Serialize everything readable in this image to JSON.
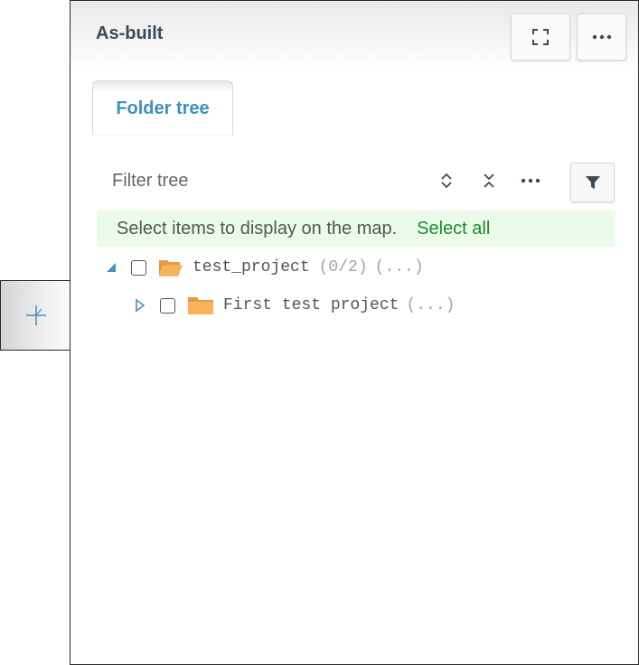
{
  "panel": {
    "title": "As-built",
    "header_buttons": {
      "expand_icon": "fullscreen-icon",
      "more_icon": "more-horizontal-icon"
    }
  },
  "tabs": [
    {
      "label": "Folder tree",
      "active": true
    }
  ],
  "toolbar": {
    "filter_placeholder": "Filter tree",
    "icons": [
      "expand-collapse-icon",
      "collapse-all-icon",
      "more-horizontal-icon",
      "filter-icon"
    ]
  },
  "banner": {
    "message": "Select items to display on the map.",
    "action": "Select all"
  },
  "tree": [
    {
      "name": "test_project",
      "count": "(0/2)",
      "ellipsis": "(...)",
      "expanded": true,
      "checked": false
    },
    {
      "name": "First test project",
      "count": "",
      "ellipsis": "(...)",
      "expanded": false,
      "checked": false
    }
  ],
  "side_tab": {
    "icon": "add-icon"
  },
  "colors": {
    "tab_text": "#3f8fc0",
    "banner_bg": "#eafbea",
    "select_all": "#1d8a2d",
    "folder": "#f2a543"
  }
}
